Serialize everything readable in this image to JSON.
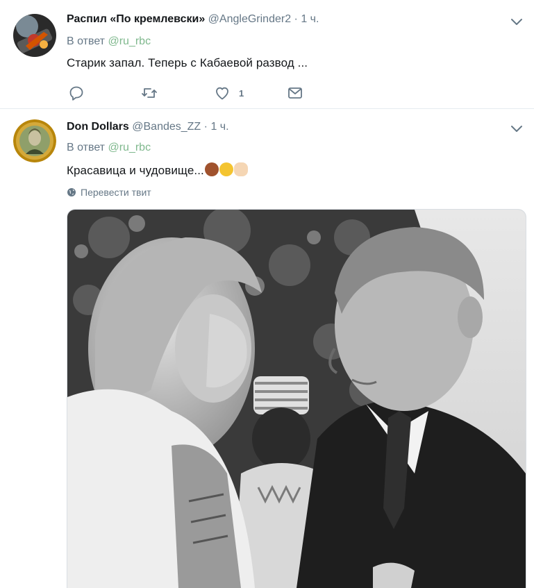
{
  "tweets": [
    {
      "name": "Распил «По кремлевски»",
      "handle": "@AngleGrinder2",
      "separator": "·",
      "time": "1 ч.",
      "reply_prefix": "В ответ",
      "reply_to": "@ru_rbc",
      "text": "Старик запал. Теперь с Кабаевой развод ...",
      "like_count": "1",
      "icons": [
        "reply-icon",
        "retweet-icon",
        "like-icon",
        "message-icon",
        "chevron-down-icon"
      ]
    },
    {
      "name": "Don Dollars",
      "handle": "@Bandes_ZZ",
      "separator": "·",
      "time": "1 ч.",
      "reply_prefix": "В ответ",
      "reply_to": "@ru_rbc",
      "text": "Красавица и чудовище...",
      "emojis": [
        "see-no-evil-monkey",
        "rolling-laughing",
        "clapping-hands"
      ],
      "translate_label": "Перевести твит",
      "icons": [
        "globe-icon",
        "chevron-down-icon"
      ]
    }
  ],
  "colors": {
    "name": "#14171a",
    "meta": "#657786",
    "mention": "#7fb88d",
    "divider": "#e6ecf0",
    "icon": "#657786"
  }
}
